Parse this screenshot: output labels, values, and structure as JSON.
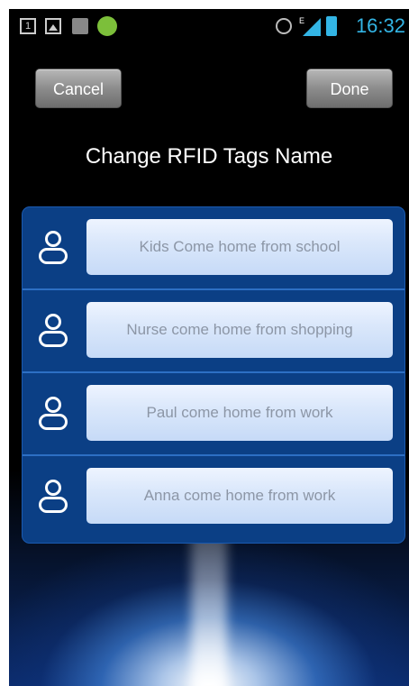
{
  "status_bar": {
    "notification_1": "1",
    "time": "16:32",
    "accent": "#33b5e5",
    "icons": [
      "notification-1-icon",
      "gallery-icon",
      "sim-icon",
      "android-icon",
      "alarm-icon",
      "signal-icon",
      "battery-icon"
    ]
  },
  "toolbar": {
    "cancel_label": "Cancel",
    "done_label": "Done"
  },
  "page": {
    "title": "Change RFID Tags Name"
  },
  "tags": [
    {
      "name": "Kids Come home from school"
    },
    {
      "name": "Nurse come home from shopping"
    },
    {
      "name": "Paul come home from work"
    },
    {
      "name": "Anna come home from work"
    }
  ]
}
